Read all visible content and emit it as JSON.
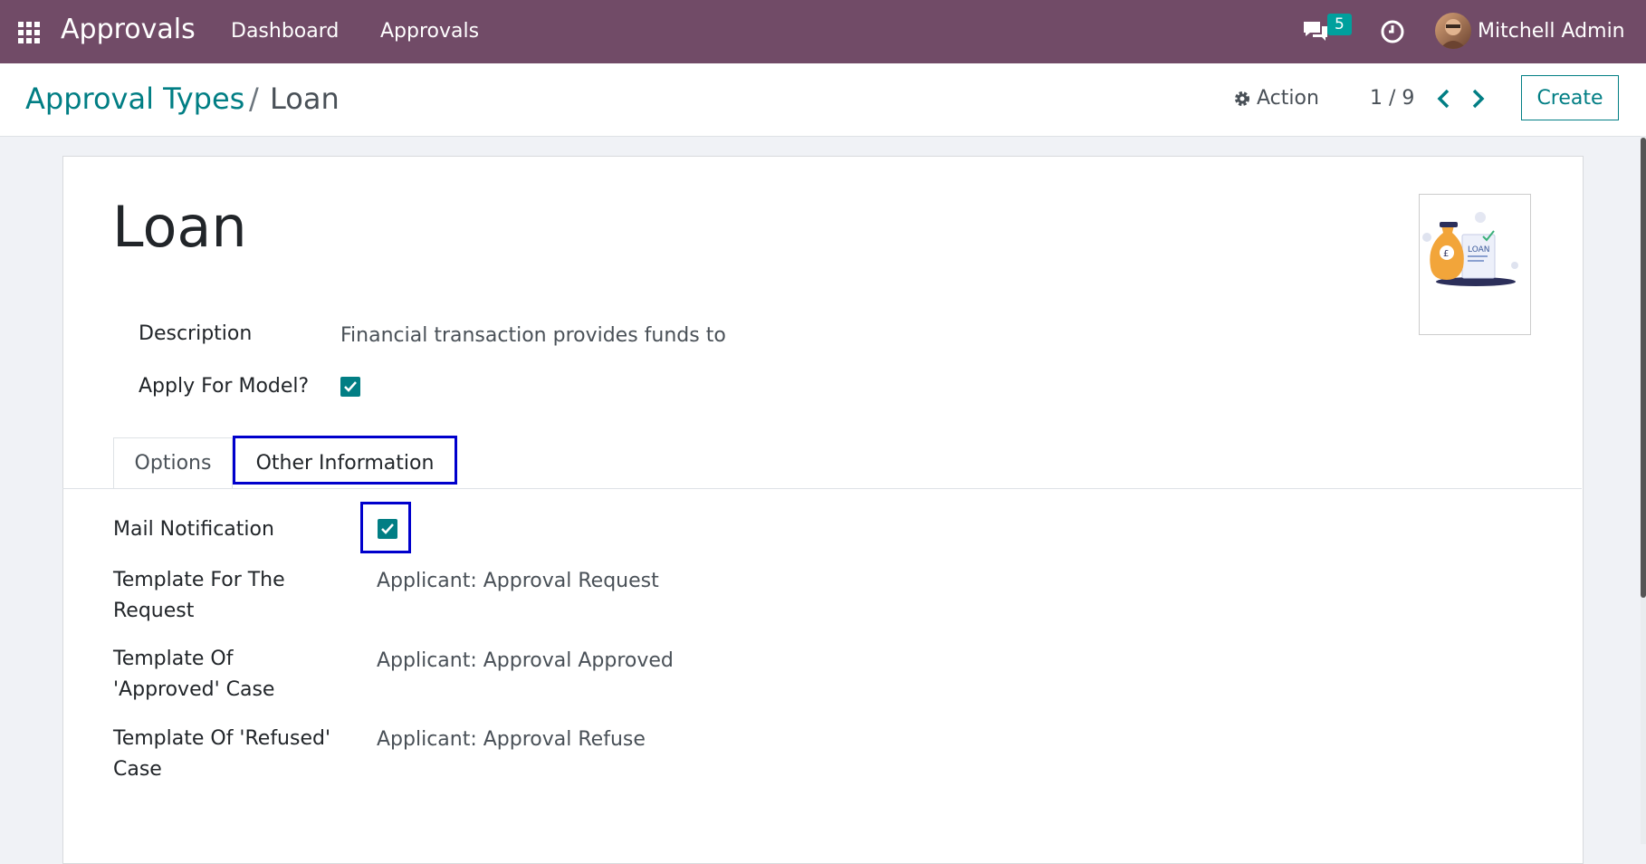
{
  "topbar": {
    "app_name": "Approvals",
    "menu": [
      "Dashboard",
      "Approvals"
    ],
    "messages_count": "5",
    "user_name": "Mitchell Admin",
    "icons": {
      "apps": "apps-grid-icon",
      "chat": "chat-icon",
      "clock": "clock-icon"
    }
  },
  "breadcrumb": {
    "parent": "Approval Types",
    "separator": "/",
    "current": "Loan"
  },
  "controls": {
    "action_label": "Action",
    "pager": "1 / 9",
    "create_label": "Create"
  },
  "record": {
    "title": "Loan",
    "image_text": "LOAN",
    "description_label": "Description",
    "description_value": "Financial transaction provides funds to",
    "apply_model_label": "Apply For Model?",
    "apply_model_checked": true
  },
  "tabs": [
    {
      "label": "Options"
    },
    {
      "label": "Other Information"
    }
  ],
  "other_info": {
    "mail_notification_label": "Mail Notification",
    "mail_notification_checked": true,
    "template_request_label_1": "Template For The",
    "template_request_label_2": "Request",
    "template_request_value": "Applicant: Approval Request",
    "template_approved_label_1": "Template Of",
    "template_approved_label_2": "'Approved' Case",
    "template_approved_value": "Applicant: Approval Approved",
    "template_refused_label_1": "Template Of 'Refused'",
    "template_refused_label_2": "Case",
    "template_refused_value": "Applicant: Approval Refuse"
  },
  "colors": {
    "brand": "#714b67",
    "accent": "#017e84",
    "badge": "#00a09d",
    "highlight": "#0000cc"
  }
}
